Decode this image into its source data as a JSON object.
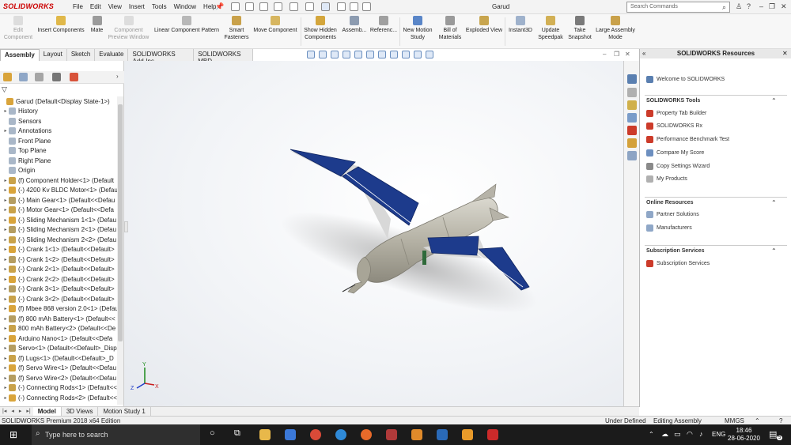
{
  "app": {
    "logo": "SOLIDWORKS",
    "doc_title": "Garud"
  },
  "menu": [
    "File",
    "Edit",
    "View",
    "Insert",
    "Tools",
    "Window",
    "Help"
  ],
  "search": {
    "placeholder": "Search Commands"
  },
  "commands": [
    {
      "label": "Edit Component",
      "enabled": false
    },
    {
      "label": "Insert Components",
      "enabled": true
    },
    {
      "label": "Mate",
      "enabled": true
    },
    {
      "label": "Component Preview Window",
      "enabled": false
    },
    {
      "label": "Linear Component Pattern",
      "enabled": true
    },
    {
      "label": "Smart Fasteners",
      "enabled": true
    },
    {
      "label": "Move Component",
      "enabled": true
    },
    {
      "label": "Show Hidden Components",
      "enabled": true
    },
    {
      "label": "Assemb...",
      "enabled": true
    },
    {
      "label": "Referenc...",
      "enabled": true
    },
    {
      "label": "New Motion Study",
      "enabled": true
    },
    {
      "label": "Bill of Materials",
      "enabled": true
    },
    {
      "label": "Exploded View",
      "enabled": true
    },
    {
      "label": "Instant3D",
      "enabled": true
    },
    {
      "label": "Update Speedpak",
      "enabled": true
    },
    {
      "label": "Take Snapshot",
      "enabled": true
    },
    {
      "label": "Large Assembly Mode",
      "enabled": true
    }
  ],
  "tabs": [
    "Assembly",
    "Layout",
    "Sketch",
    "Evaluate",
    "SOLIDWORKS Add-Ins",
    "SOLIDWORKS MBD"
  ],
  "tree": [
    {
      "label": "Garud  (Default<Display State-1>)",
      "level": 0,
      "exp": false
    },
    {
      "label": "History",
      "level": 1,
      "exp": true
    },
    {
      "label": "Sensors",
      "level": 1,
      "exp": false
    },
    {
      "label": "Annotations",
      "level": 1,
      "exp": true
    },
    {
      "label": "Front Plane",
      "level": 1,
      "exp": false
    },
    {
      "label": "Top Plane",
      "level": 1,
      "exp": false
    },
    {
      "label": "Right Plane",
      "level": 1,
      "exp": false
    },
    {
      "label": "Origin",
      "level": 1,
      "exp": false
    },
    {
      "label": "(f) Component Holder<1> (Default",
      "level": 1,
      "exp": true
    },
    {
      "label": "(-) 4200 Kv BLDC Motor<1> (Defau",
      "level": 1,
      "exp": true
    },
    {
      "label": "(-) Main Gear<1> (Default<<Defau",
      "level": 1,
      "exp": true
    },
    {
      "label": "(-) Motor Gear<1> (Default<<Defa",
      "level": 1,
      "exp": true
    },
    {
      "label": "(-) Sliding Mechanism 1<1> (Defau",
      "level": 1,
      "exp": true
    },
    {
      "label": "(-) Sliding Mechanism 2<1> (Defau",
      "level": 1,
      "exp": true
    },
    {
      "label": "(-) Sliding Mechanism 2<2> (Defau",
      "level": 1,
      "exp": true
    },
    {
      "label": "(-) Crank 1<1> (Default<<Default>",
      "level": 1,
      "exp": true
    },
    {
      "label": "(-) Crank 1<2> (Default<<Default>",
      "level": 1,
      "exp": true
    },
    {
      "label": "(-) Crank 2<1> (Default<<Default>",
      "level": 1,
      "exp": true
    },
    {
      "label": "(-) Crank 2<2> (Default<<Default>",
      "level": 1,
      "exp": true
    },
    {
      "label": "(-) Crank 3<1> (Default<<Default>",
      "level": 1,
      "exp": true
    },
    {
      "label": "(-) Crank 3<2> (Default<<Default>",
      "level": 1,
      "exp": true
    },
    {
      "label": "(f) Mbee 868 version 2.0<1> (Defau",
      "level": 1,
      "exp": true
    },
    {
      "label": "(f) 800 mAh Battery<1> (Default<<",
      "level": 1,
      "exp": true
    },
    {
      "label": "800 mAh Battery<2> (Default<<De",
      "level": 1,
      "exp": true
    },
    {
      "label": "Arduino Nano<1> (Default<<Defa",
      "level": 1,
      "exp": true
    },
    {
      "label": "Servo<1> (Default<<Default>_Disp",
      "level": 1,
      "exp": true
    },
    {
      "label": "(f) Lugs<1> (Default<<Default>_D",
      "level": 1,
      "exp": true
    },
    {
      "label": "(f) Servo Wire<1> (Default<<Defau",
      "level": 1,
      "exp": true
    },
    {
      "label": "(f) Servo Wire<2> (Default<<Defau",
      "level": 1,
      "exp": true
    },
    {
      "label": "(-) Connecting Rods<1> (Default<<",
      "level": 1,
      "exp": true
    },
    {
      "label": "(-) Connecting Rods<2> (Default<<",
      "level": 1,
      "exp": true
    }
  ],
  "triad": {
    "x": "X",
    "y": "Y",
    "z": "Z"
  },
  "resources": {
    "title": "SOLIDWORKS Resources",
    "welcome": "Welcome to SOLIDWORKS",
    "tools_title": "SOLIDWORKS Tools",
    "tools": [
      "Property Tab Builder",
      "SOLIDWORKS Rx",
      "Performance Benchmark Test",
      "Compare My Score",
      "Copy Settings Wizard",
      "My Products"
    ],
    "online_title": "Online Resources",
    "online": [
      "Partner Solutions",
      "Manufacturers"
    ],
    "subs_title": "Subscription Services",
    "subs": [
      "Subscription Services"
    ]
  },
  "bottom_tabs": [
    "Model",
    "3D Views",
    "Motion Study 1"
  ],
  "status": {
    "edition": "SOLIDWORKS Premium 2018 x64 Edition",
    "defined": "Under Defined",
    "mode": "Editing Assembly",
    "units": "MMGS"
  },
  "taskbar": {
    "search_placeholder": "Type here to search",
    "lang": "ENG",
    "time": "18:46",
    "date": "28-06-2020",
    "notifications": "5"
  },
  "colors": {
    "accent": "#c00000",
    "wing_blue": "#1a3a8a",
    "body_gray": "#b9b7aa"
  }
}
